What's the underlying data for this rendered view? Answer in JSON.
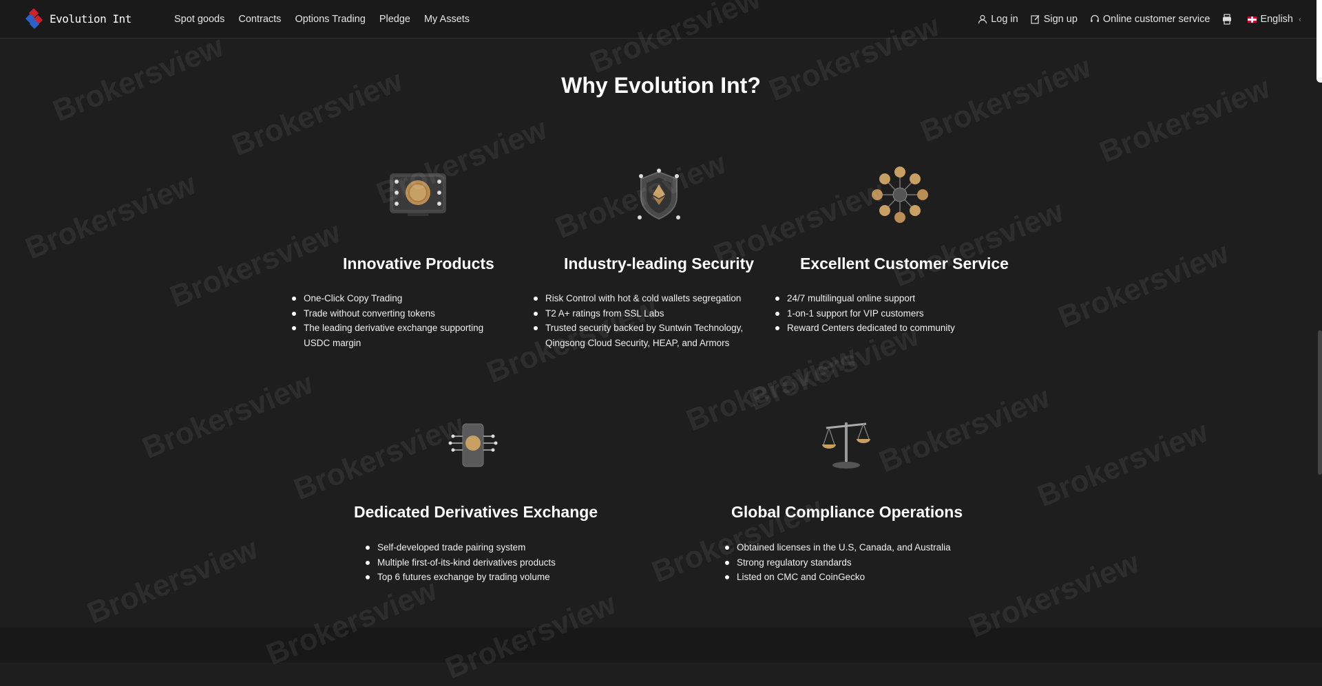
{
  "nav": {
    "brand": "Evolution Int",
    "menu": [
      "Spot goods",
      "Contracts",
      "Options Trading",
      "Pledge",
      "My Assets"
    ],
    "login": "Log in",
    "signup": "Sign up",
    "support": "Online customer service",
    "language": "English"
  },
  "main": {
    "title": "Why Evolution Int?",
    "features": [
      {
        "icon": "coin-board-icon",
        "title": "Innovative Products",
        "points": [
          "One-Click Copy Trading",
          "Trade without converting tokens",
          "The leading derivative exchange supporting USDC margin"
        ]
      },
      {
        "icon": "shield-eth-icon",
        "title": "Industry-leading Security",
        "points": [
          "Risk Control with hot & cold wallets segregation",
          "T2 A+ ratings from SSL Labs",
          "Trusted security backed by Suntwin Technology, Qingsong Cloud Security, HEAP, and Armors"
        ]
      },
      {
        "icon": "coin-network-icon",
        "title": "Excellent Customer Service",
        "points": [
          "24/7 multilingual online support",
          "1-on-1 support for VIP customers",
          "Reward Centers dedicated to community"
        ]
      },
      {
        "icon": "phone-chip-icon",
        "title": "Dedicated Derivatives Exchange",
        "points": [
          "Self-developed trade pairing system",
          "Multiple first-of-its-kind derivatives products",
          "Top 6 futures exchange by trading volume"
        ]
      },
      {
        "icon": "balance-scale-icon",
        "title": "Global Compliance Operations",
        "points": [
          "Obtained licenses in the U.S, Canada, and Australia",
          "Strong regulatory standards",
          "Listed on CMC and CoinGecko"
        ]
      }
    ]
  },
  "watermark": "Brokersview",
  "colors": {
    "background": "#1e1e1e",
    "gold": "#c9a063",
    "nav": "#1a1a1a"
  }
}
